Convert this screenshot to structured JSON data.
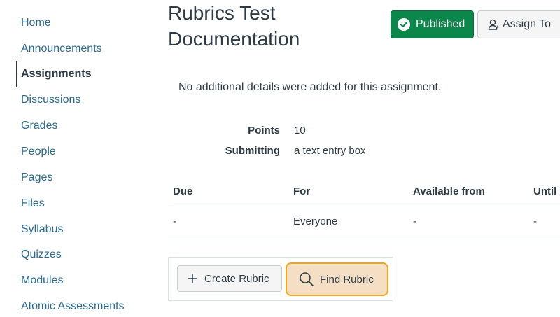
{
  "sidebar": {
    "items": [
      {
        "label": "Home"
      },
      {
        "label": "Announcements"
      },
      {
        "label": "Assignments",
        "active": true
      },
      {
        "label": "Discussions"
      },
      {
        "label": "Grades"
      },
      {
        "label": "People"
      },
      {
        "label": "Pages"
      },
      {
        "label": "Files"
      },
      {
        "label": "Syllabus"
      },
      {
        "label": "Quizzes"
      },
      {
        "label": "Modules"
      },
      {
        "label": "Atomic Assessments"
      }
    ]
  },
  "header": {
    "title": "Rubrics Test Documentation",
    "published_label": "Published",
    "assign_label": "Assign To"
  },
  "assignment": {
    "details": "No additional details were added for this assignment.",
    "points_label": "Points",
    "points_value": "10",
    "submitting_label": "Submitting",
    "submitting_value": "a text entry box"
  },
  "dates_table": {
    "headers": [
      "Due",
      "For",
      "Available from",
      "Until"
    ],
    "rows": [
      [
        "-",
        "Everyone",
        "-",
        "-"
      ]
    ]
  },
  "rubric": {
    "create_label": "Create Rubric",
    "find_label": "Find Rubric"
  },
  "colors": {
    "published_green": "#0b874b",
    "link_blue": "#2b6a8f",
    "focus_orange": "#f0a81e"
  },
  "icons": {
    "published": "check-circle-icon",
    "assign": "user-icon",
    "create": "plus-icon",
    "find": "search-icon"
  }
}
